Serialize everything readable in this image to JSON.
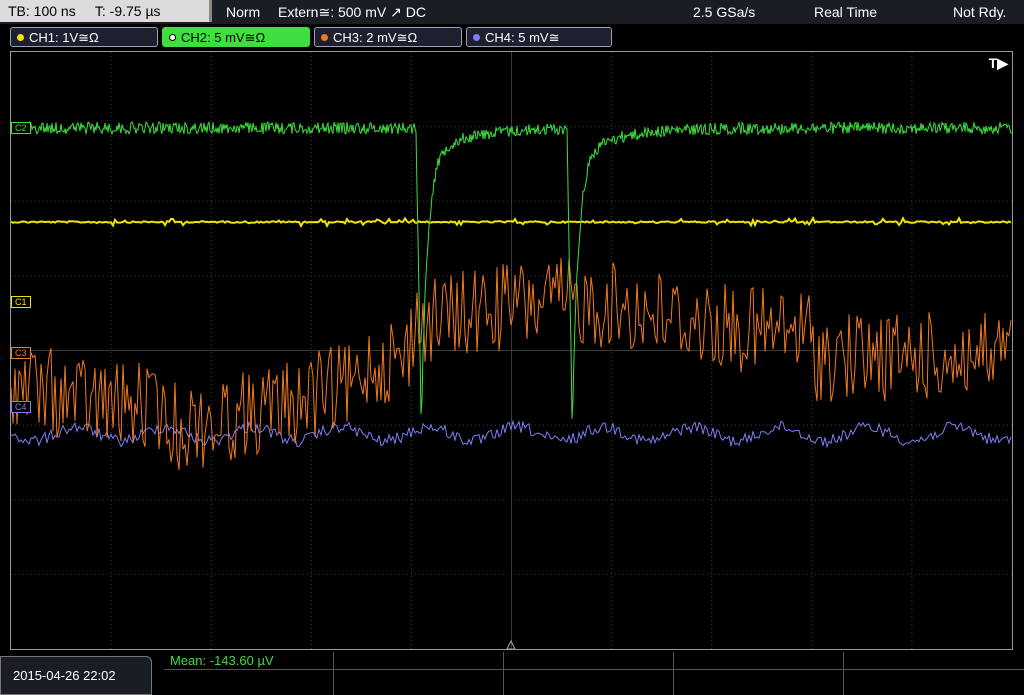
{
  "topbar": {
    "timebase": "TB: 100 ns",
    "trigger_time": "T: -9.75 µs",
    "acq_mode": "Norm",
    "trigger_source": "Extern≅: 500 mV ↗ DC",
    "sample_rate": "2.5 GSa/s",
    "mode": "Real Time",
    "status": "Not Rdy."
  },
  "channels": [
    {
      "label": "CH1: 1V≅Ω",
      "color": "#f2e400",
      "active": false
    },
    {
      "label": "CH2: 5 mV≅Ω",
      "color": "#3dde3d",
      "active": true
    },
    {
      "label": "CH3: 2 mV≅Ω",
      "color": "#f07a1c",
      "active": false
    },
    {
      "label": "CH4: 5 mV≅",
      "color": "#7d7df2",
      "active": false
    }
  ],
  "markers": {
    "c1": "C1",
    "c2": "C2",
    "c3": "C3",
    "c4": "C4"
  },
  "trigger_marker": "T▶",
  "measurement": {
    "label": "Mean: -143.60 µV"
  },
  "timestamp": "2015-04-26 22:02",
  "colors": {
    "ch1": "#f2e400",
    "ch2": "#3dde3d",
    "ch3": "#f07a1c",
    "ch4": "#7d7df2",
    "grid": "#3a3a3a"
  }
}
